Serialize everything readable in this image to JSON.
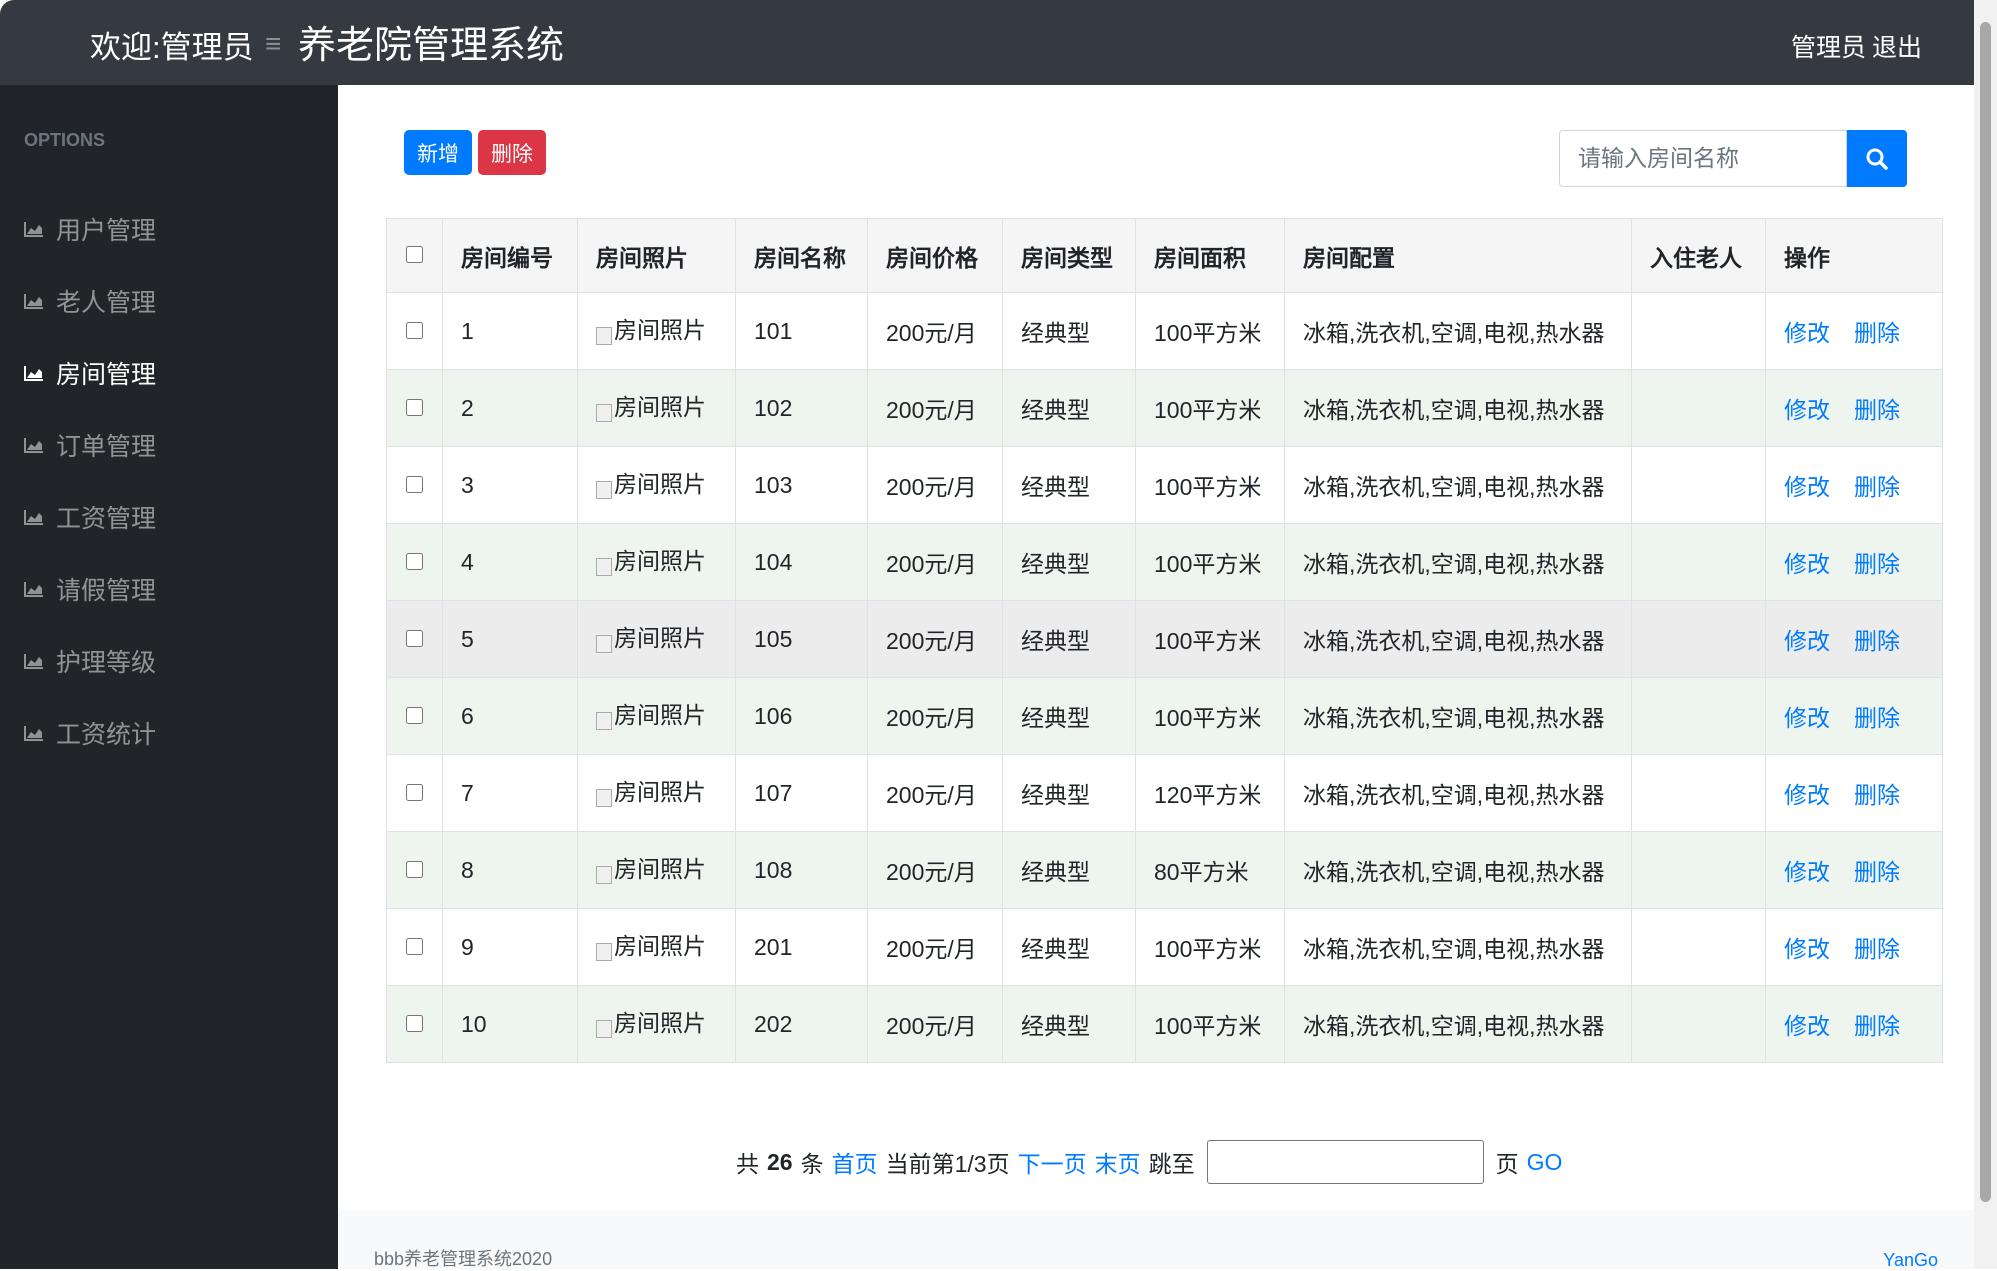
{
  "header": {
    "welcome": "欢迎:管理员",
    "menu_icon": "hamburger-icon",
    "title": "养老院管理系统",
    "user": "管理员",
    "logout": "退出"
  },
  "sidebar": {
    "section": "OPTIONS",
    "items": [
      {
        "label": "用户管理",
        "icon": "area-chart-icon"
      },
      {
        "label": "老人管理",
        "icon": "area-chart-icon"
      },
      {
        "label": "房间管理",
        "icon": "area-chart-icon",
        "active": true
      },
      {
        "label": "订单管理",
        "icon": "area-chart-icon"
      },
      {
        "label": "工资管理",
        "icon": "area-chart-icon"
      },
      {
        "label": "请假管理",
        "icon": "area-chart-icon"
      },
      {
        "label": "护理等级",
        "icon": "area-chart-icon"
      },
      {
        "label": "工资统计",
        "icon": "area-chart-icon"
      }
    ]
  },
  "toolbar": {
    "add": "新增",
    "delete": "删除",
    "search_placeholder": "请输入房间名称",
    "search_icon": "search-icon"
  },
  "table": {
    "headers": [
      "房间编号",
      "房间照片",
      "房间名称",
      "房间价格",
      "房间类型",
      "房间面积",
      "房间配置",
      "入住老人",
      "操作"
    ],
    "edit_label": "修改",
    "delete_label": "删除",
    "rows": [
      [
        "1",
        "房间照片",
        "101",
        "200元/月",
        "经典型",
        "100平方米",
        "冰箱,洗衣机,空调,电视,热水器",
        ""
      ],
      [
        "2",
        "房间照片",
        "102",
        "200元/月",
        "经典型",
        "100平方米",
        "冰箱,洗衣机,空调,电视,热水器",
        ""
      ],
      [
        "3",
        "房间照片",
        "103",
        "200元/月",
        "经典型",
        "100平方米",
        "冰箱,洗衣机,空调,电视,热水器",
        ""
      ],
      [
        "4",
        "房间照片",
        "104",
        "200元/月",
        "经典型",
        "100平方米",
        "冰箱,洗衣机,空调,电视,热水器",
        ""
      ],
      [
        "5",
        "房间照片",
        "105",
        "200元/月",
        "经典型",
        "100平方米",
        "冰箱,洗衣机,空调,电视,热水器",
        ""
      ],
      [
        "6",
        "房间照片",
        "106",
        "200元/月",
        "经典型",
        "100平方米",
        "冰箱,洗衣机,空调,电视,热水器",
        ""
      ],
      [
        "7",
        "房间照片",
        "107",
        "200元/月",
        "经典型",
        "120平方米",
        "冰箱,洗衣机,空调,电视,热水器",
        ""
      ],
      [
        "8",
        "房间照片",
        "108",
        "200元/月",
        "经典型",
        "80平方米",
        "冰箱,洗衣机,空调,电视,热水器",
        ""
      ],
      [
        "9",
        "房间照片",
        "201",
        "200元/月",
        "经典型",
        "100平方米",
        "冰箱,洗衣机,空调,电视,热水器",
        ""
      ],
      [
        "10",
        "房间照片",
        "202",
        "200元/月",
        "经典型",
        "100平方米",
        "冰箱,洗衣机,空调,电视,热水器",
        ""
      ]
    ]
  },
  "pager": {
    "total_prefix": "共",
    "total": "26",
    "total_suffix": "条",
    "first": "首页",
    "current": "当前第1/3页",
    "next": "下一页",
    "last": "末页",
    "jump": "跳至",
    "jump_value": "",
    "page": "页",
    "go": "GO"
  },
  "footer": {
    "left": "bbb养老管理系统2020",
    "right": "YanGo"
  },
  "colors": {
    "primary": "#007bff",
    "danger": "#dc3545",
    "header": "#343a40",
    "sidebar": "#212529"
  }
}
